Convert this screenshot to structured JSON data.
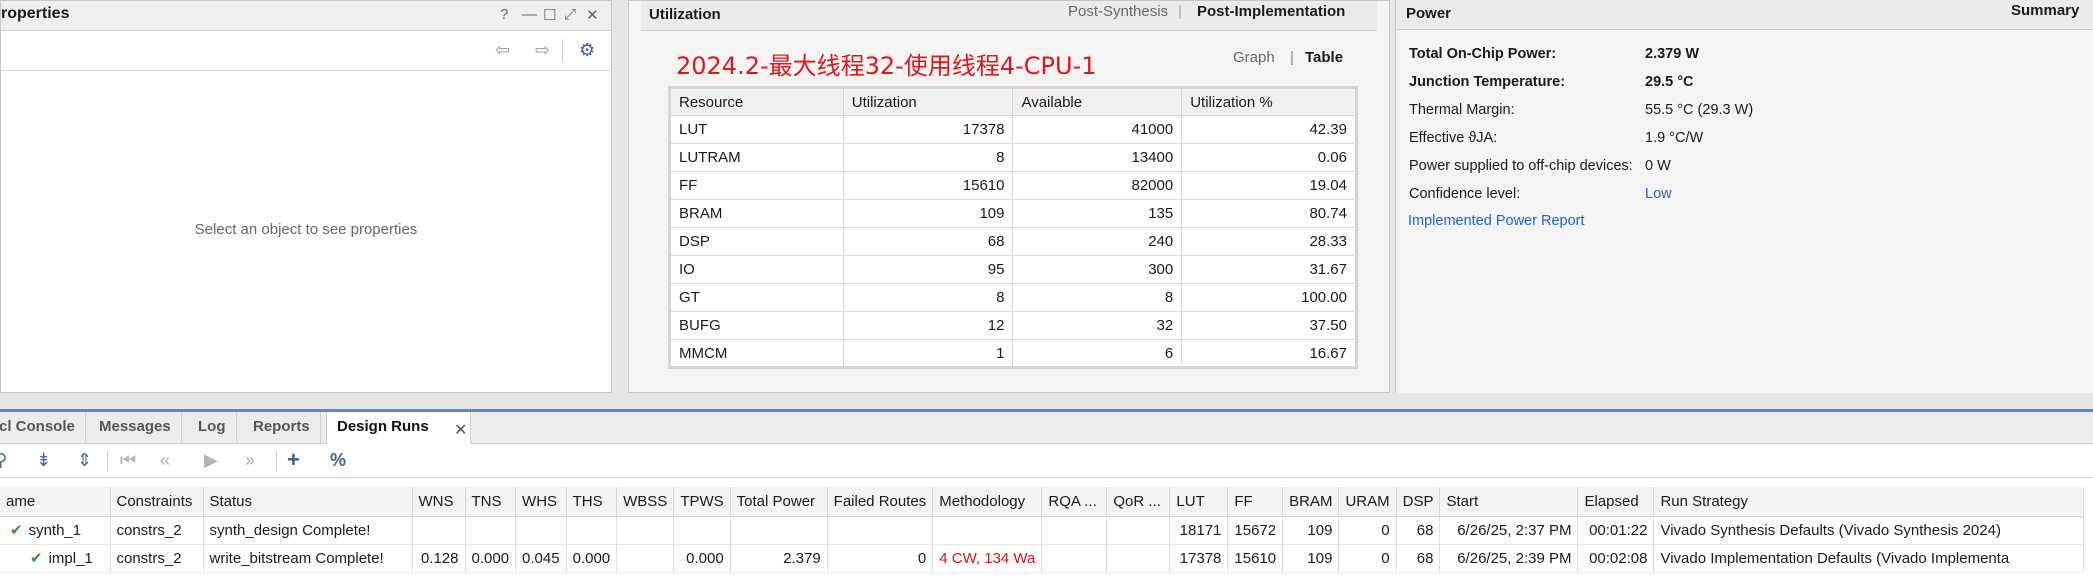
{
  "properties": {
    "title": "roperties",
    "controls": [
      "?",
      "—",
      "☐",
      "⤢",
      "✕"
    ],
    "empty_message": "Select an object to see properties"
  },
  "utilization": {
    "title": "Utilization",
    "tabs": [
      "Post-Synthesis",
      "Post-Implementation"
    ],
    "active_tab": "Post-Implementation",
    "watermark_text": "2024.2-最大线程32-使用线程4-CPU-1",
    "views": [
      "Graph",
      "Table"
    ],
    "active_view": "Table",
    "columns": [
      "Resource",
      "Utilization",
      "Available",
      "Utilization %"
    ],
    "rows": [
      [
        "LUT",
        "17378",
        "41000",
        "42.39"
      ],
      [
        "LUTRAM",
        "8",
        "13400",
        "0.06"
      ],
      [
        "FF",
        "15610",
        "82000",
        "19.04"
      ],
      [
        "BRAM",
        "109",
        "135",
        "80.74"
      ],
      [
        "DSP",
        "68",
        "240",
        "28.33"
      ],
      [
        "IO",
        "95",
        "300",
        "31.67"
      ],
      [
        "GT",
        "8",
        "8",
        "100.00"
      ],
      [
        "BUFG",
        "12",
        "32",
        "37.50"
      ],
      [
        "MMCM",
        "1",
        "6",
        "16.67"
      ]
    ]
  },
  "power": {
    "title": "Power",
    "summary_label": "Summary",
    "rows": [
      {
        "label": "Total On-Chip Power:",
        "value": "2.379 W",
        "bold": true
      },
      {
        "label": "Junction Temperature:",
        "value": "29.5 °C",
        "bold": true
      },
      {
        "label": "Thermal Margin:",
        "value": "55.5 °C (29.3 W)",
        "bold": false
      },
      {
        "label": "Effective ϑJA:",
        "value": "1.9 °C/W",
        "bold": false
      },
      {
        "label": "Power supplied to off-chip devices:",
        "value": "0 W",
        "bold": false
      },
      {
        "label": "Confidence level:",
        "value": "Low",
        "bold": false
      }
    ],
    "report_link": "Implemented Power Report"
  },
  "bottom": {
    "tabs": [
      "cl Console",
      "Messages",
      "Log",
      "Reports",
      "Design Runs"
    ],
    "active_tab": "Design Runs",
    "toolbar_icons": [
      "search-icon",
      "collapse-all-icon",
      "expand-all-icon",
      "first-icon",
      "previous-icon",
      "run-icon",
      "next-icon",
      "add-icon",
      "percent-icon"
    ],
    "columns": [
      "ame",
      "Constraints",
      "Status",
      "WNS",
      "TNS",
      "WHS",
      "THS",
      "WBSS",
      "TPWS",
      "Total Power",
      "Failed Routes",
      "Methodology",
      "RQA ...",
      "QoR ...",
      "LUT",
      "FF",
      "BRAM",
      "URAM",
      "DSP",
      "Start",
      "Elapsed",
      "Run Strategy"
    ],
    "runs": [
      {
        "name": "synth_1",
        "constraints": "constrs_2",
        "status": "synth_design Complete!",
        "wns": "",
        "tns": "",
        "whs": "",
        "ths": "",
        "wbss": "",
        "tpws": "",
        "total_power": "",
        "failed_routes": "",
        "methodology": "",
        "rqa": "",
        "qor": "",
        "lut": "18171",
        "ff": "15672",
        "bram": "109",
        "uram": "0",
        "dsp": "68",
        "start": "6/26/25, 2:37 PM",
        "elapsed": "00:01:22",
        "strategy": "Vivado Synthesis Defaults (Vivado Synthesis 2024)"
      },
      {
        "name": "impl_1",
        "constraints": "constrs_2",
        "status": "write_bitstream Complete!",
        "wns": "0.128",
        "tns": "0.000",
        "whs": "0.045",
        "ths": "0.000",
        "wbss": "",
        "tpws": "0.000",
        "total_power": "2.379",
        "failed_routes": "0",
        "methodology": "4 CW, 134 Wa",
        "rqa": "",
        "qor": "",
        "lut": "17378",
        "ff": "15610",
        "bram": "109",
        "uram": "0",
        "dsp": "68",
        "start": "6/26/25, 2:39 PM",
        "elapsed": "00:02:08",
        "strategy": "Vivado Implementation Defaults (Vivado Implementa"
      }
    ],
    "methodology_color": "#d41414",
    "check_color": "#2e9a2e"
  }
}
